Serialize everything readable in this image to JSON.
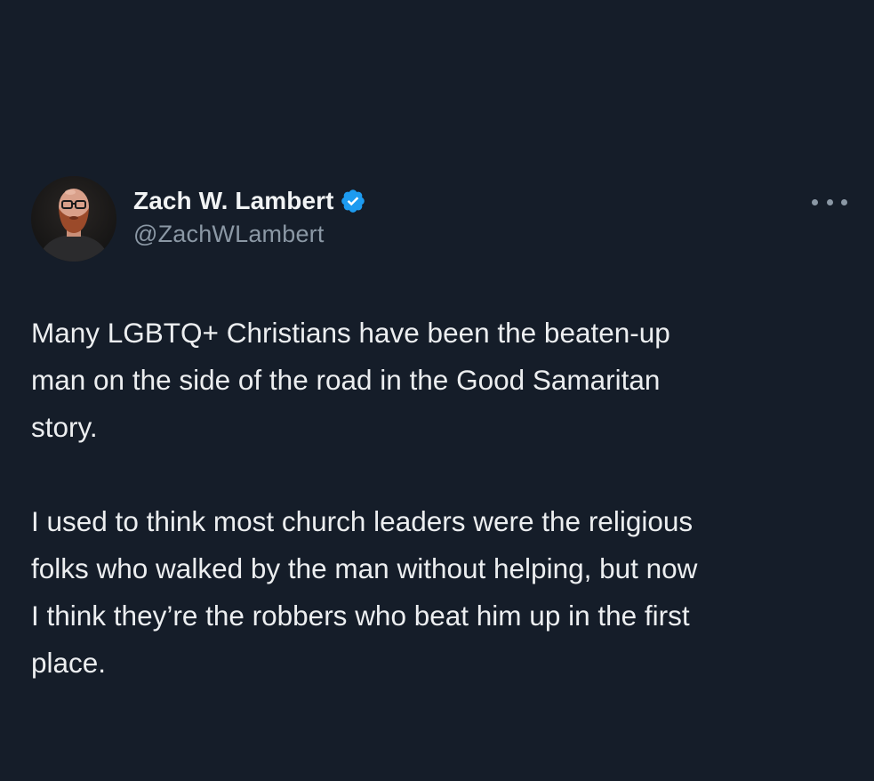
{
  "tweet": {
    "author": {
      "display_name": "Zach W. Lambert",
      "handle": "@ZachWLambert",
      "verified_icon": "verified-badge-icon",
      "verified_color": "#1d9bf0"
    },
    "more_icon": "more-options-icon",
    "paragraphs": [
      "Many LGBTQ+ Christians have been the beaten-up\nman on the side of the road in the Good Samaritan\nstory.",
      "I used to think most church leaders were the religious\nfolks who walked by the man without helping, but now\nI think they’re the robbers who beat him up in the first\nplace."
    ]
  },
  "colors": {
    "background": "#151d29",
    "text_primary": "#eceef0",
    "text_secondary": "#8b98a5"
  }
}
